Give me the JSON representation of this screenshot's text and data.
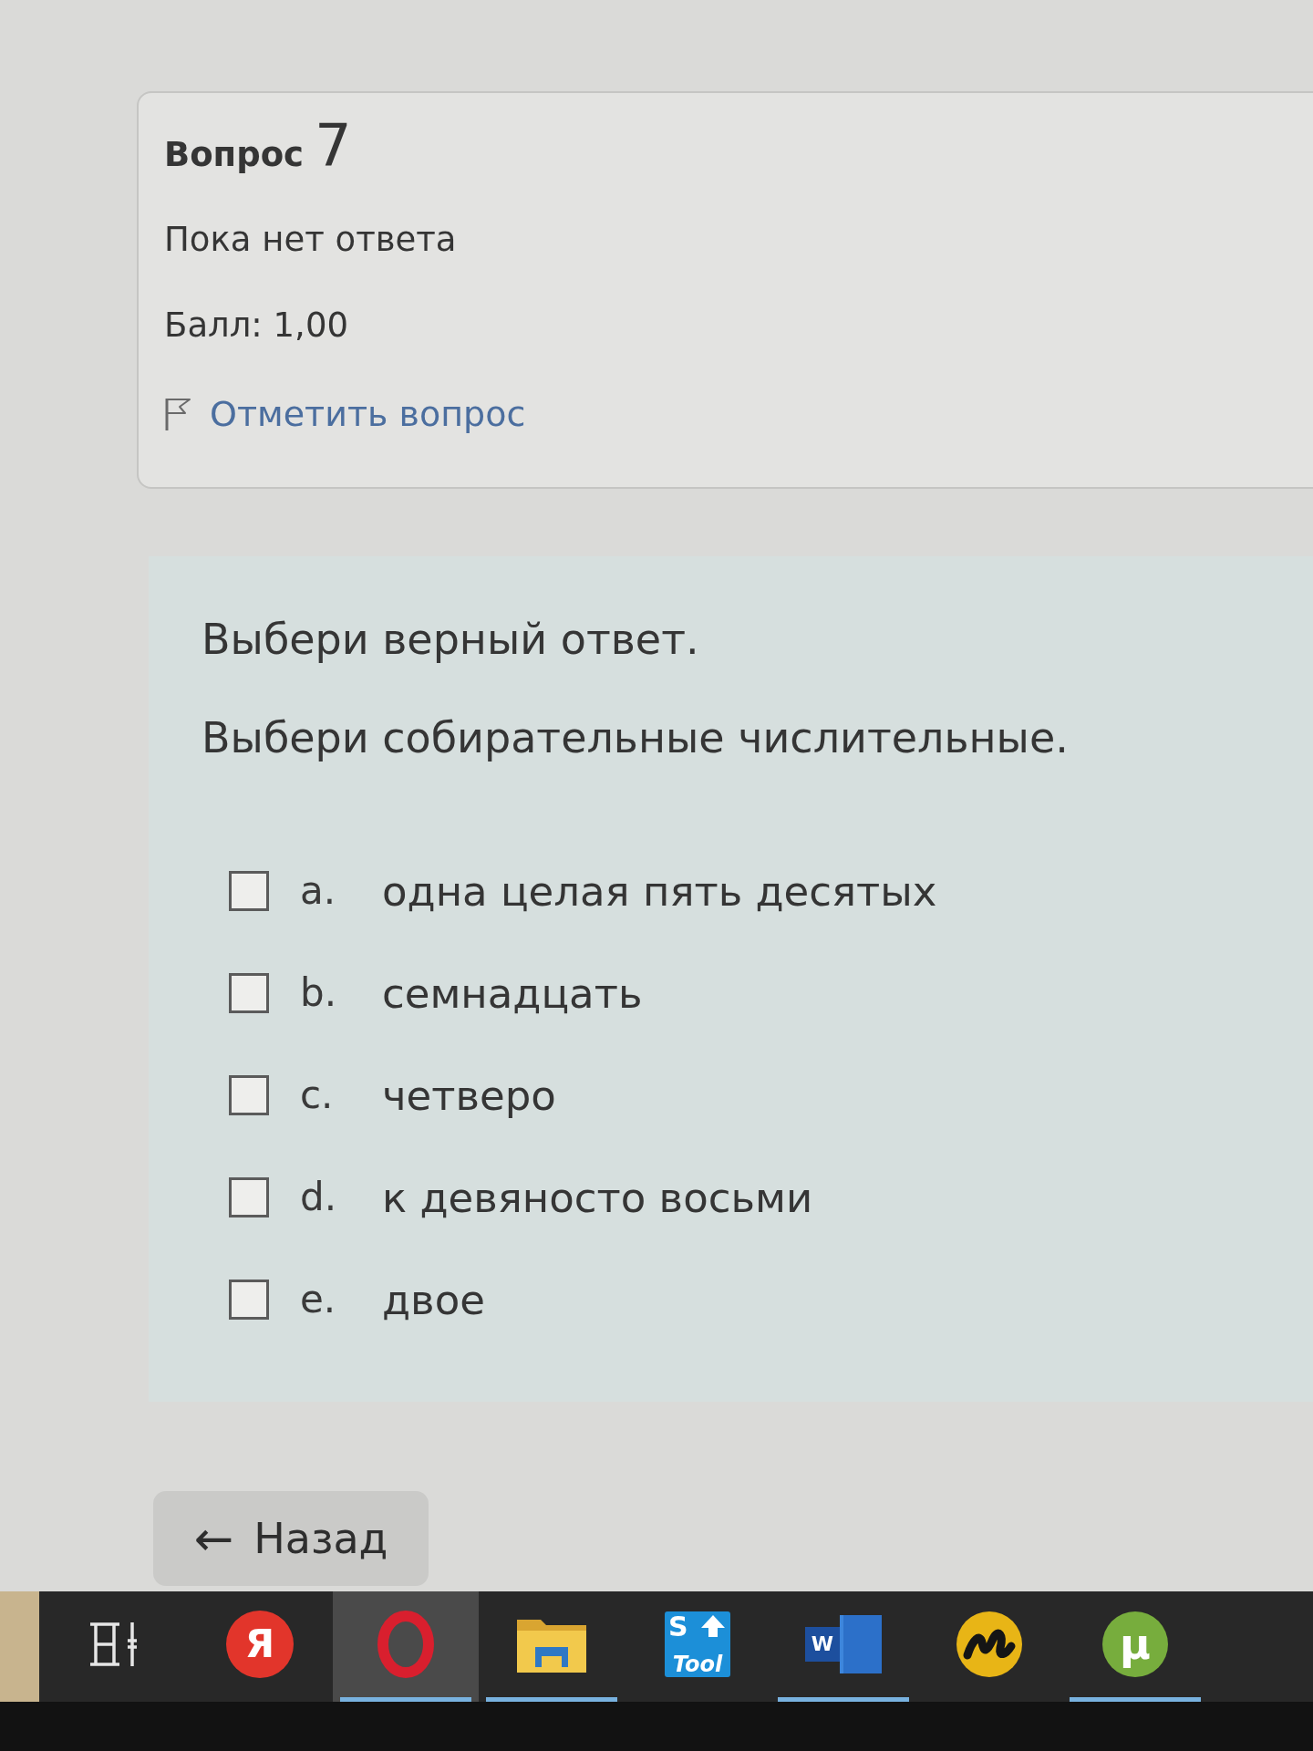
{
  "question": {
    "title": "Вопрос",
    "number": "7",
    "status": "Пока нет ответа",
    "mark": "Балл: 1,00",
    "flag_link": "Отметить вопрос",
    "flagged": false
  },
  "formulation": {
    "instruction": "Выбери верный ответ.",
    "prompt": "Выбери собирательные числительные.",
    "options": [
      {
        "letter": "a.",
        "text": "одна целая пять десятых",
        "checked": false
      },
      {
        "letter": "b.",
        "text": "семнадцать",
        "checked": false
      },
      {
        "letter": "c.",
        "text": "четверо",
        "checked": false
      },
      {
        "letter": "d.",
        "text": "к девяносто восьми",
        "checked": false
      },
      {
        "letter": "e.",
        "text": "двое",
        "checked": false
      }
    ]
  },
  "navigation": {
    "back_button": {
      "arrow": "←",
      "label": "Назад"
    }
  },
  "taskbar": {
    "apps": [
      {
        "kind": "task_view",
        "running": false,
        "selected": false
      },
      {
        "kind": "yandex",
        "glyph": "Я",
        "running": false,
        "selected": false
      },
      {
        "kind": "opera",
        "running": true,
        "selected": true
      },
      {
        "kind": "explorer",
        "running": true,
        "selected": false
      },
      {
        "kind": "stool",
        "glyph": "S",
        "caption": "Tool",
        "running": false,
        "selected": false
      },
      {
        "kind": "word",
        "glyph": "W",
        "running": true,
        "selected": false
      },
      {
        "kind": "squiggle",
        "running": false,
        "selected": false
      },
      {
        "kind": "utorrent",
        "glyph": "µ",
        "running": true,
        "selected": false
      }
    ]
  }
}
